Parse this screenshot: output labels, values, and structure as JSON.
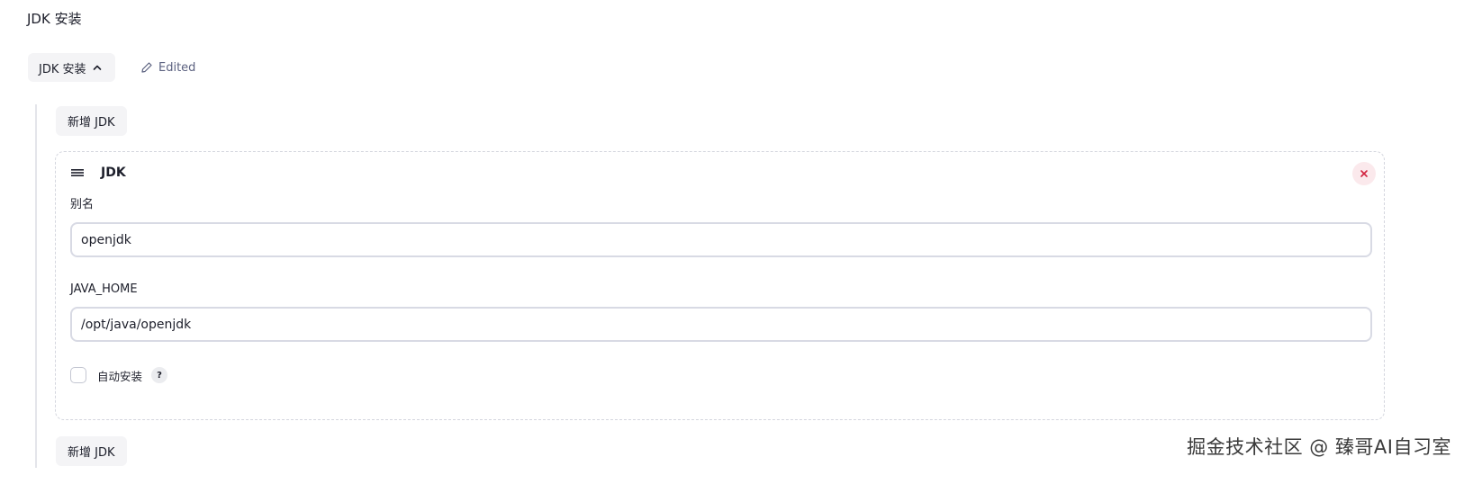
{
  "section": {
    "title": "JDK 安装"
  },
  "toggle": {
    "label": "JDK 安装",
    "icon": "chevron-up-icon"
  },
  "status": {
    "icon": "pencil-icon",
    "label": "Edited"
  },
  "actions": {
    "add_top_label": "新增 JDK",
    "add_bottom_label": "新增 JDK"
  },
  "jdk_card": {
    "title": "JDK",
    "drag_icon": "drag-handle-icon",
    "close_icon": "close-icon",
    "fields": {
      "alias_label": "别名",
      "alias_value": "openjdk",
      "java_home_label": "JAVA_HOME",
      "java_home_value": "/opt/java/openjdk"
    },
    "auto_install": {
      "label": "自动安装",
      "checked": false,
      "help": "?"
    }
  },
  "watermark": "掘金技术社区 @ 臻哥AI自习室",
  "colors": {
    "close_bg": "#fbe9ec",
    "close_icon": "#d2233f",
    "button_bg": "#f4f4f6",
    "border": "#d8dae4"
  }
}
